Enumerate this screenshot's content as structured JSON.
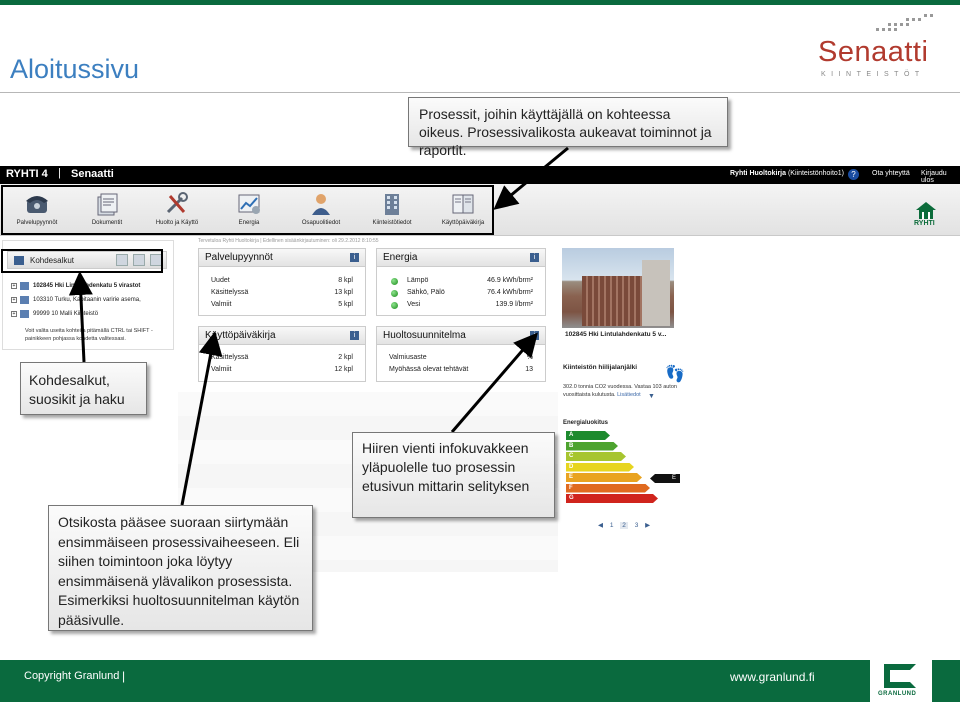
{
  "slide": {
    "title": "Aloitussivu",
    "brand_logo": {
      "word": "Senaatti",
      "sub": "KIINTEISTÖT"
    }
  },
  "app": {
    "title": "RYHTI 4",
    "separator": "|",
    "brand": "Senaatti",
    "user_role": "Ryhti Huoltokirja",
    "user_detail": "(Kiinteistönhoito1)",
    "help_label": "?",
    "contact_label": "Ota yhteyttä",
    "logout_label": "Kirjaudu ulos",
    "corner_logo_text": "RYHTI"
  },
  "nav": [
    {
      "label": "Palvelupyynnöt",
      "icon": "phone-icon"
    },
    {
      "label": "Dokumentit",
      "icon": "document-icon"
    },
    {
      "label": "Huolto ja Käyttö",
      "icon": "tools-icon"
    },
    {
      "label": "Energia",
      "icon": "energy-chart-icon"
    },
    {
      "label": "Osapuolitiedot",
      "icon": "person-icon"
    },
    {
      "label": "Kiinteistötiedot",
      "icon": "building-icon"
    },
    {
      "label": "Käyttöpäiväkirja",
      "icon": "logbook-icon"
    }
  ],
  "left_panel": {
    "title": "Kohdesalkut",
    "tree": [
      "102845 Hki Lintulahdenkatu 5 virastot",
      "103310 Turku, Kapitaanin varirie asema,",
      "99999 10 Malli Kiinteistö"
    ],
    "hint": "Voit valita useita kohteita pitämällä CTRL tai SHIFT -painikkeen pohjassa kohdetta valitessasi."
  },
  "breadcrumb": "Tervetuloa Ryhti Huoltokirja | Edellinen sisäänkirjautuminen: oli 29.2.2012 8:10:55",
  "panels": {
    "palvelupyynnot": {
      "title": "Palvelupyynnöt",
      "rows": [
        {
          "k": "Uudet",
          "v": "8 kpl"
        },
        {
          "k": "Käsittelyssä",
          "v": "13 kpl"
        },
        {
          "k": "Valmiit",
          "v": "5 kpl"
        }
      ]
    },
    "energia": {
      "title": "Energia",
      "rows": [
        {
          "k": "Lämpö",
          "v": "46.9 kWh/brm²"
        },
        {
          "k": "Sähkö, Pälö",
          "v": "76.4 kWh/brm²"
        },
        {
          "k": "Vesi",
          "v": "139.9 l/brm²"
        }
      ]
    },
    "kayttopaivakirja": {
      "title": "Käyttöpäiväkirja",
      "rows": [
        {
          "k": "Käsittelyssä",
          "v": "2 kpl"
        },
        {
          "k": "Valmiit",
          "v": "12 kpl"
        }
      ]
    },
    "huoltosuunnitelma": {
      "title": "Huoltosuunnitelma",
      "rows": [
        {
          "k": "Valmiusaste",
          "v": "%"
        },
        {
          "k": "Myöhässä olevat tehtävät",
          "v": "13"
        }
      ]
    },
    "info_icon": "i"
  },
  "property": {
    "name": "102845 Hki Lintulahdenkatu 5 v...",
    "carbon_title": "Kiinteistön hiilijalanjälki",
    "carbon_text": "302.0 tonnia CO2 vuodessa. Vastaa 103 auton vuosittaista kulutusta.",
    "carbon_more": "Lisätiedot",
    "energy_title": "Energialuokitus",
    "energy_classes": [
      {
        "label": "A",
        "color": "#1d8a2e"
      },
      {
        "label": "B",
        "color": "#4da32f"
      },
      {
        "label": "C",
        "color": "#a7c52f"
      },
      {
        "label": "D",
        "color": "#e7d51f"
      },
      {
        "label": "E",
        "color": "#e9a320"
      },
      {
        "label": "F",
        "color": "#e06a1f"
      },
      {
        "label": "G",
        "color": "#d0241d"
      }
    ],
    "energy_value": "E",
    "pager": [
      "1",
      "2",
      "3"
    ],
    "pager_current": "2"
  },
  "callouts": {
    "process": "Prosessit, joihin käyttäjällä on kohteessa oikeus. Prosessivalikosta aukeavat toiminnot ja raportit.",
    "kohdesalkut": "Kohdesalkut, suosikit ja haku",
    "otsikosta": "Otsikosta pääsee suoraan siirtymään ensimmäiseen prosessivaiheeseen. Eli siihen toimintoon joka löytyy ensimmäisenä ylävalikon prosessista. Esimerkiksi huoltosuunnitelman käytön pääsivulle.",
    "infokuvake": "Hiiren vienti infokuvakkeen yläpuolelle tuo prosessin etusivun mittarin selityksen"
  },
  "footer": {
    "copyright": "Copyright Granlund",
    "separator": "|",
    "website": "www.granlund.fi",
    "logo_text": "GRANLUND"
  }
}
